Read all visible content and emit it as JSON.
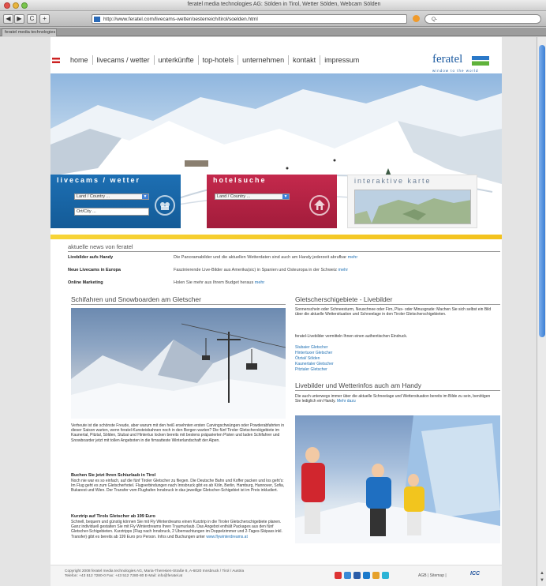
{
  "browser": {
    "window_title": "feratel media technologies AG: Sölden in Tirol, Wetter Sölden, Webcam Sölden",
    "url": "http://www.feratel.com/livecams-wetter/oesterreich/tirol/soelden.html",
    "search_placeholder": "Q-",
    "tab_label": "feratel media technologies",
    "nav_buttons": [
      "◀",
      "▶",
      "C",
      "+"
    ]
  },
  "site": {
    "nav": [
      "home",
      "livecams / wetter",
      "unterkünfte",
      "top-hotels",
      "unternehmen",
      "kontakt",
      "impressum"
    ],
    "logo": {
      "name": "feratel",
      "tagline": "window to the world"
    },
    "boxes": {
      "livecams": {
        "title": "livecams / wetter",
        "select": "Land / Country ...",
        "input": "Ort/City ..."
      },
      "hotel": {
        "title": "hotelsuche",
        "select": "Land / Country ..."
      },
      "map": {
        "title": "interaktive karte"
      }
    },
    "news": {
      "heading": "aktuelle news von feratel",
      "more": "mehr",
      "items": [
        {
          "title": "Livebilder aufs Handy",
          "text": "Die Panoramabilder und die aktuellen Wetterdaten sind auch am Handy jederzeit abrufbar "
        },
        {
          "title": "Neue Livecams in Europa",
          "text": "Faszinierende Live-Bilder aus Amerika(sic) in Spanien und Osteuropa in der Schweiz "
        },
        {
          "title": "Online Marketing",
          "text": "Holen Sie mehr aus Ihrem Budget heraus "
        }
      ]
    },
    "left": {
      "title": "Schifahren und Snowboarden am Gletscher",
      "intro": "Verheute ist die schönste Freude, aber warum mit den heiß ersehnten ersten Carvingschwüngen oder Powderabfahrten in dieser Saison warten, wenn feratel-Kunsteisbahnen noch in den Bergen warten? Die fünf Tiroler Gletscherskigebiete im Kaunertal, Pitztal, Sölden, Stubai und Hintertux locken bereits mit bestens präparierten Pisten und laden Schifahrer und Snowboarder jetzt mit tollen Angeboten in die firnsatteste Winterlandschaft der Alpen.",
      "block1_head": "Buchen Sie jetzt Ihren Schiurlaub in Tirol",
      "block1_text": "Noch nie war es so einfach, auf die fünf Tiroler Gletscher zu fliegen. Die Deutsche Bahn und Koffer packen und los geht's: Im Flug geht es zum Gletscherhotel. Flugverbindungen nach Innsbruck gibt es ab Köln, Berlin, Hamburg, Hannover, Sofia, Bukarest und Wien. Der Transfer vom Flughafen Innsbruck in das jeweilige Gletscher-Schigebiet ist im Preis inkludiert.",
      "block2_head": "Kurztrip auf Tirols Gletscher ab 199 Euro",
      "block2_text": "Schnell, bequem und günstig können Sie mit Fly Winterdreams einen Kurztrip in die Tiroler Gletscherschigebiete planen. Ganz individuell gestalten Sie mit Fly Winterdreams Ihren Traumurlaub. Das Angebot enthält Packages aus den fünf Gletscher-Schigebieten. Kurztripps (Flug nach Innsbruck, 2 Übernachtungen im Doppelzimmer und 2-Tages-Skipass inkl. Transfer) gibt es bereits ab 199 Euro pro Person. Infos und Buchungen unter",
      "block2_link": "www.flywinterdreams.at"
    },
    "right": {
      "title1": "Gletscherschigebiete - Livebilder",
      "text1": "Sonnenschein oder Schneesturm, Neuschnee oder Firn, Plus- oder Minusgrade: Machen Sie sich selbst ein Bild über die aktuelle Wettersituation und Schneelage in den Tiroler Gletscherschigebieten.",
      "text2": "feratel-Livebilder vermitteln Ihnen einen authentischen Eindruck.",
      "links": [
        "Stubaier Gletscher",
        "Hintertuxer Gletscher",
        "Ötztal/ Sölden",
        "Kaunertaler Gletscher",
        "Pitztaler Gletscher"
      ],
      "title2": "Livebilder und Wetterinfos auch am Handy",
      "text3": "Die auch unterwegs immer über die aktuelle Schneelage und Wettersituation bereits im Bilde zu sein, benötigen Sie lediglich ein Handy.",
      "more": "Mehr dazu"
    },
    "footer": {
      "line1": "Copyright 2008 feratel media technologies AG,   Maria-Theresien-Straße 8, A-6020 Innsbruck / Tirol / Austria",
      "line2": "Telefon: +43 512 7280-0   Fax: +43 512 7280-80   E-Mail: info@feratel.at",
      "links": "AGB  |  Sitemap  |",
      "icc": "ICC"
    }
  }
}
